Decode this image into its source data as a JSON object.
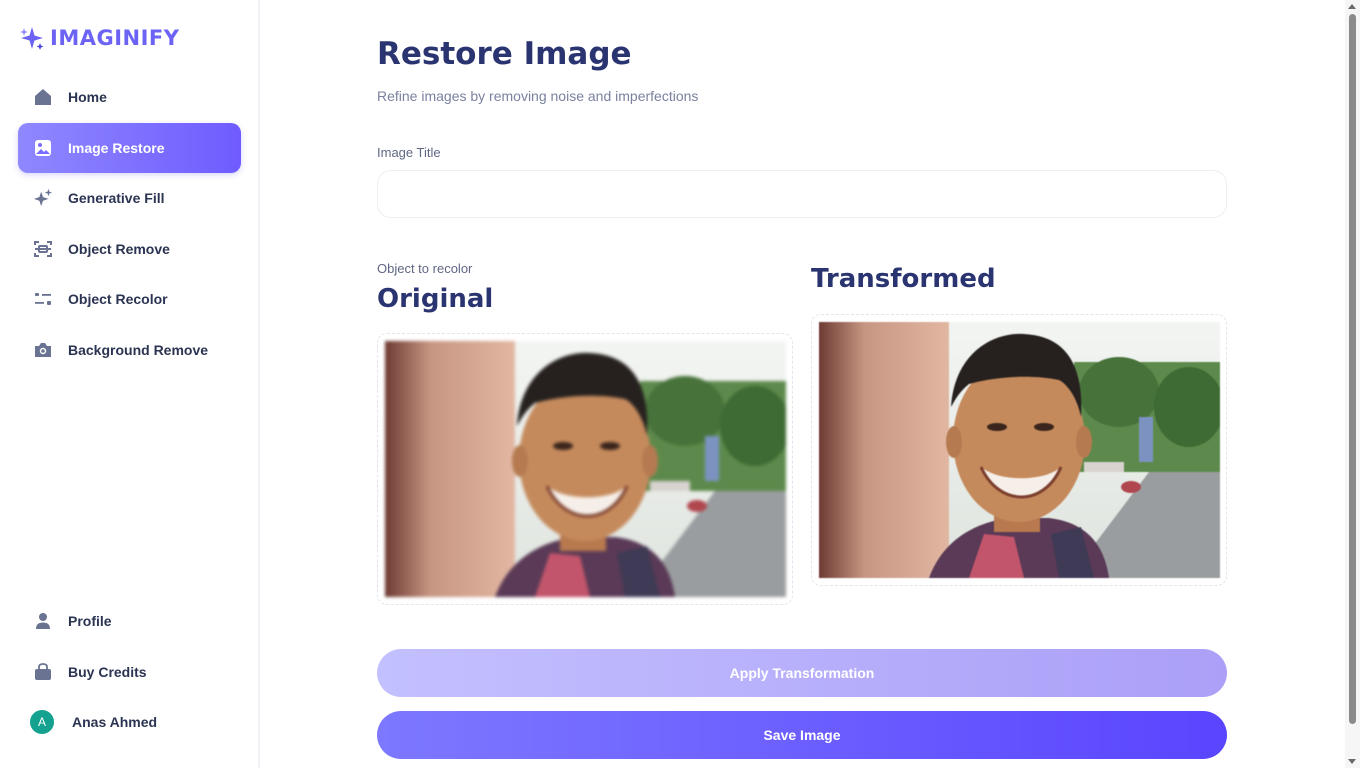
{
  "app": {
    "logo_text": "IMAGINIFY"
  },
  "sidebar": {
    "items": [
      {
        "label": "Home",
        "icon": "home-icon"
      },
      {
        "label": "Image Restore",
        "icon": "image-icon",
        "active": true
      },
      {
        "label": "Generative Fill",
        "icon": "sparkles-icon"
      },
      {
        "label": "Object Remove",
        "icon": "scan-icon"
      },
      {
        "label": "Object Recolor",
        "icon": "filter-icon"
      },
      {
        "label": "Background Remove",
        "icon": "camera-icon"
      }
    ],
    "bottom_items": [
      {
        "label": "Profile",
        "icon": "user-icon"
      },
      {
        "label": "Buy Credits",
        "icon": "bag-icon"
      }
    ],
    "user": {
      "initial": "A",
      "name": "Anas Ahmed"
    }
  },
  "main": {
    "title": "Restore Image",
    "subtitle": "Refine images by removing noise and imperfections",
    "image_title_label": "Image Title",
    "image_title_value": "",
    "object_label": "Object to recolor",
    "original_heading": "Original",
    "transformed_heading": "Transformed",
    "apply_button": "Apply Transformation",
    "save_button": "Save Image"
  },
  "colors": {
    "accent": "#6c63f5",
    "heading": "#2a3470",
    "apply_button": "#b7b2fb",
    "save_button": "#6a5cff",
    "avatar": "#12a28f"
  }
}
